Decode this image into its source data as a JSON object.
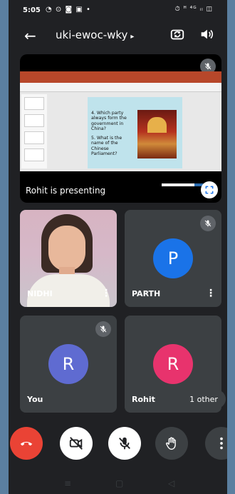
{
  "status": {
    "time": "5:05",
    "notifications": "◔ ⊙ ◙ ▣ •",
    "system": "⏱ ᴴ ⁴ᴳ ᵢₗ ◫"
  },
  "header": {
    "meeting_code": "uki-ewoc-wky",
    "caret": "▸"
  },
  "presentation": {
    "presenting_label": "Rohit is presenting",
    "slide": {
      "question_4": "4. Which party always form the government in China?",
      "question_5": "5. What is the name of the Chinese Parliament?"
    }
  },
  "participants": [
    {
      "name": "NIDHI",
      "muted": false,
      "video": true
    },
    {
      "name": "PARTH",
      "initial": "P",
      "muted": true,
      "color": "#1a73e8"
    },
    {
      "name": "You",
      "initial": "R",
      "muted": true,
      "color": "#5f6bd1"
    },
    {
      "name": "Rohit",
      "initial": "R",
      "muted": false,
      "color": "#e8336d"
    }
  ],
  "other_chip": "1 other",
  "colors": {
    "end_call": "#ea4335",
    "tile_bg": "#3c4043",
    "screen_bg": "#202124"
  },
  "controls": {
    "end_call_icon": "phone-hangup-icon",
    "camera_icon": "camera-off-icon",
    "mic_icon": "mic-off-icon",
    "raise_hand_icon": "hand-icon",
    "more_icon": "more-vert-icon"
  }
}
